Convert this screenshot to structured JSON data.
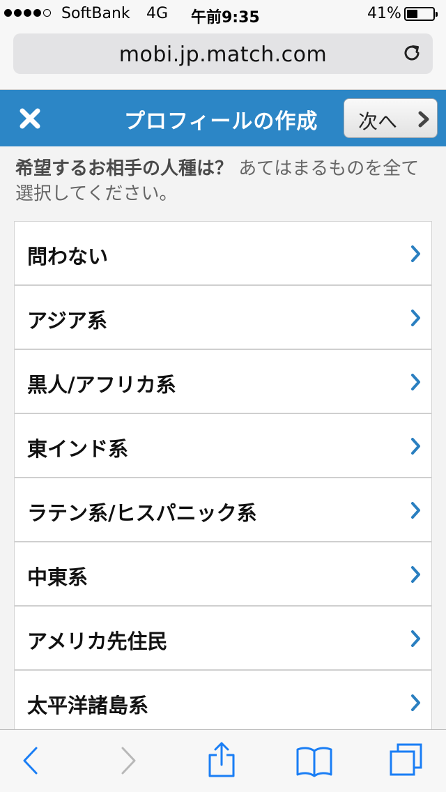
{
  "status_bar": {
    "carrier": "SoftBank",
    "network": "4G",
    "time": "午前9:35",
    "battery_percent": "41%",
    "battery_level": 0.41
  },
  "browser": {
    "url": "mobi.jp.match.com"
  },
  "header": {
    "title": "プロフィールの作成",
    "next_label": "次へ"
  },
  "question": {
    "main": "希望するお相手の人種は？",
    "sub": "あてはまるものを全て選択してください。"
  },
  "options": [
    {
      "label": "問わない"
    },
    {
      "label": "アジア系"
    },
    {
      "label": "黒人/アフリカ系"
    },
    {
      "label": "東インド系"
    },
    {
      "label": "ラテン系/ヒスパニック系"
    },
    {
      "label": "中東系"
    },
    {
      "label": "アメリカ先住民"
    },
    {
      "label": "太平洋諸島系"
    }
  ],
  "colors": {
    "header_blue": "#2c86c6",
    "chevron_blue": "#2a7fc0",
    "toolbar_blue": "#1a7ef5"
  },
  "icons": {
    "close": "close-icon",
    "next_chevron": "chevron-right-icon",
    "reload": "reload-icon",
    "back": "back-icon",
    "forward": "forward-icon",
    "share": "share-icon",
    "bookmarks": "bookmarks-icon",
    "tabs": "tabs-icon"
  }
}
